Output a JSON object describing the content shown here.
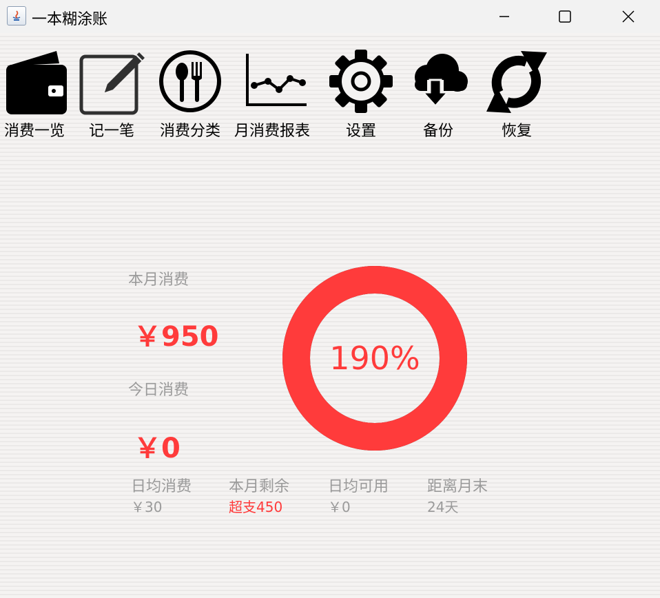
{
  "window": {
    "title": "一本糊涂账"
  },
  "toolbar": {
    "items": [
      {
        "label": "消费一览",
        "icon": "wallet-icon"
      },
      {
        "label": "记一笔",
        "icon": "edit-note-icon"
      },
      {
        "label": "消费分类",
        "icon": "cutlery-icon"
      },
      {
        "label": "月消费报表",
        "icon": "line-chart-icon"
      },
      {
        "label": "设置",
        "icon": "gear-icon"
      },
      {
        "label": "备份",
        "icon": "cloud-download-icon"
      },
      {
        "label": "恢复",
        "icon": "refresh-icon"
      }
    ]
  },
  "summary": {
    "month_label": "本月消费",
    "month_amount": "￥950",
    "today_label": "今日消费",
    "today_amount": "￥0",
    "progress_text": "190%",
    "progress_fraction": 1.9,
    "accent_color": "#ff3b3b"
  },
  "stats": [
    {
      "label": "日均消费",
      "value": "￥30"
    },
    {
      "label": "本月剩余",
      "value": "超支450"
    },
    {
      "label": "日均可用",
      "value": "￥0"
    },
    {
      "label": "距离月末",
      "value": "24天"
    }
  ]
}
